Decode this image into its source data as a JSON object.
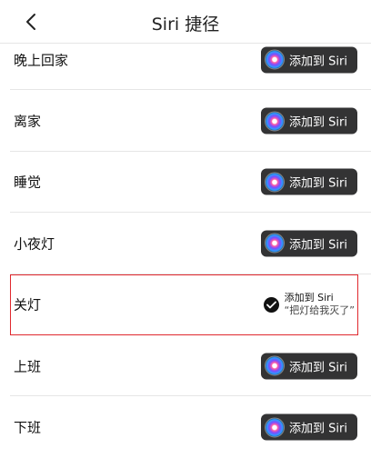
{
  "header": {
    "title": "Siri 捷径"
  },
  "button_label": "添加到 Siri",
  "rows": [
    {
      "label": "晚上回家",
      "added": false
    },
    {
      "label": "离家",
      "added": false
    },
    {
      "label": "睡觉",
      "added": false
    },
    {
      "label": "小夜灯",
      "added": false
    },
    {
      "label": "关灯",
      "added": true,
      "added_title": "添加到 Siri",
      "added_phrase": "“把灯给我灭了”"
    },
    {
      "label": "上班",
      "added": false
    },
    {
      "label": "下班",
      "added": false
    }
  ]
}
